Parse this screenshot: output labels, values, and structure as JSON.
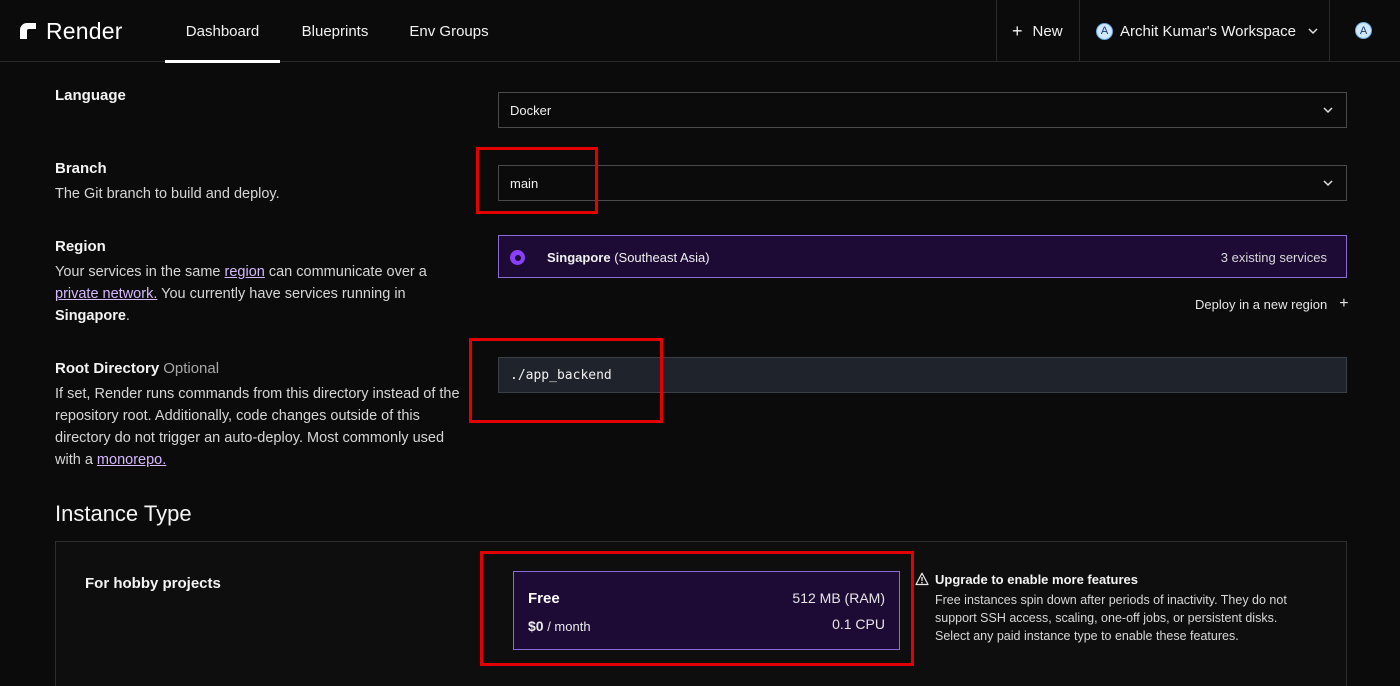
{
  "nav": {
    "logo_text": "Render",
    "tabs": [
      {
        "label": "Dashboard",
        "active": true
      },
      {
        "label": "Blueprints",
        "active": false
      },
      {
        "label": "Env Groups",
        "active": false
      }
    ],
    "new_label": "New",
    "workspace_label": "Archit Kumar's Workspace",
    "workspace_avatar": "A",
    "user_avatar": "A"
  },
  "language": {
    "label": "Language",
    "value": "Docker"
  },
  "branch": {
    "label": "Branch",
    "description": "The Git branch to build and deploy.",
    "value": "main"
  },
  "region": {
    "label": "Region",
    "desc_part1": "Your services in the same ",
    "link_region": "region",
    "desc_part2": " can communicate over a ",
    "link_private_network": "private network.",
    "desc_part3": " You currently have services running in ",
    "bold_location": "Singapore",
    "desc_part4": ".",
    "selected_name": "Singapore",
    "selected_area": " (Southeast Asia)",
    "existing_services": "3 existing services",
    "deploy_new_label": "Deploy in a new region"
  },
  "root_directory": {
    "label": "Root Directory",
    "optional_label": "Optional",
    "desc_part1": "If set, Render runs commands from this directory instead of the repository root. Additionally, code changes outside of this directory do not trigger an auto-deploy. Most commonly used with a ",
    "link_monorepo": "monorepo.",
    "value": "./app_backend"
  },
  "instance_type": {
    "title": "Instance Type",
    "group_label": "For hobby projects",
    "plan": {
      "name": "Free",
      "price": "$0",
      "price_suffix": " / month",
      "ram": "512 MB (RAM)",
      "cpu": "0.1 CPU"
    },
    "upgrade_title": "Upgrade to enable more features",
    "upgrade_text": "Free instances spin down after periods of inactivity. They do not support SSH access, scaling, one-off jobs, or persistent disks. Select any paid instance type to enable these features."
  },
  "colors": {
    "background": "#0b0b0b",
    "accent_purple": "#8a3ffc",
    "selected_bg": "#1d0b36",
    "highlight_red": "#e30000"
  }
}
